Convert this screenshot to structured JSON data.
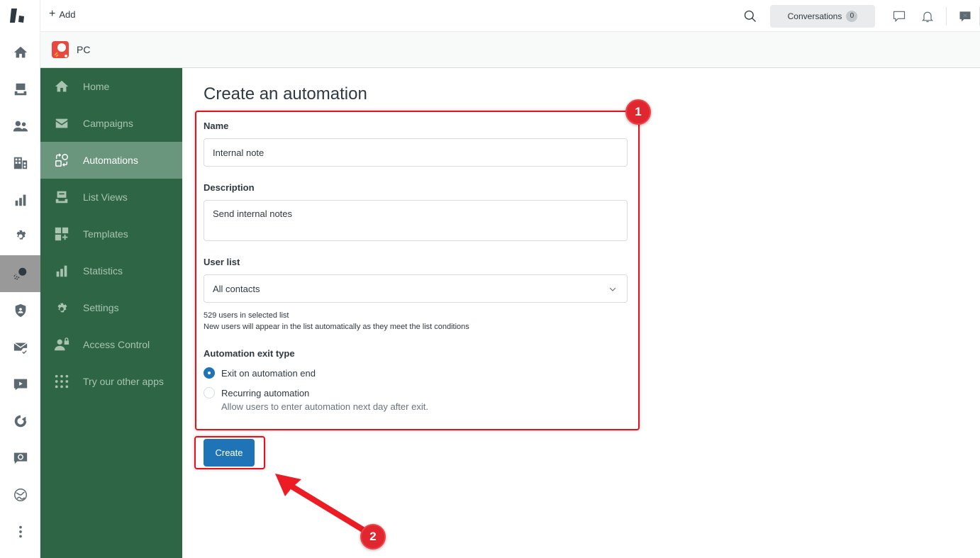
{
  "topbar": {
    "add_label": "Add",
    "conversations_label": "Conversations",
    "conversations_count": "0"
  },
  "rail": {
    "items": [
      "home-icon",
      "views-icon",
      "customers-icon",
      "organizations-icon",
      "reporting-icon",
      "admin-icon",
      "proactive-campaigns-icon",
      "shield-icon",
      "mail-check-icon",
      "video-icon",
      "chart-icon",
      "chat-sync-icon",
      "globe-icon",
      "more-icon"
    ],
    "active": "proactive-campaigns-icon"
  },
  "app": {
    "title": "PC",
    "accent": "#e8483d"
  },
  "sidenav": {
    "items": [
      {
        "label": "Home",
        "icon": "home-icon"
      },
      {
        "label": "Campaigns",
        "icon": "mail-icon"
      },
      {
        "label": "Automations",
        "icon": "automation-icon",
        "active": true
      },
      {
        "label": "List Views",
        "icon": "list-views-icon"
      },
      {
        "label": "Templates",
        "icon": "templates-icon"
      },
      {
        "label": "Statistics",
        "icon": "bar-chart-icon"
      },
      {
        "label": "Settings",
        "icon": "gear-icon"
      },
      {
        "label": "Access Control",
        "icon": "user-lock-icon"
      },
      {
        "label": "Try our other apps",
        "icon": "grid-icon"
      }
    ],
    "bg_color": "#2e6645"
  },
  "form": {
    "title": "Create an automation",
    "name_label": "Name",
    "name_value": "Internal note",
    "description_label": "Description",
    "description_value": "Send internal notes",
    "user_list_label": "User list",
    "user_list_value": "All contacts",
    "user_count_hint": "529 users in selected list",
    "user_list_hint": "New users will appear in the list automatically as they meet the list conditions",
    "exit_type_label": "Automation exit type",
    "exit_options": [
      {
        "label": "Exit on automation end",
        "checked": true
      },
      {
        "label": "Recurring automation",
        "sub": "Allow users to enter automation next day after exit.",
        "checked": false
      }
    ],
    "create_label": "Create"
  },
  "annotations": {
    "step1": "1",
    "step2": "2",
    "color": "#e8101a"
  }
}
